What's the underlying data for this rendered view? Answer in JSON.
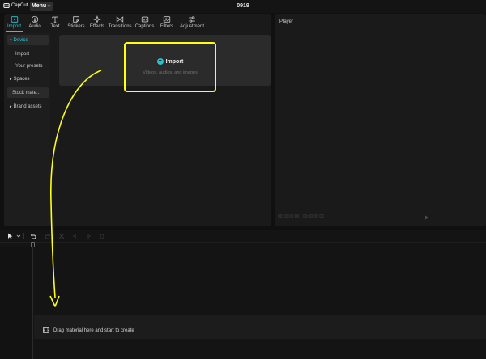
{
  "titlebar": {
    "logo_text": "CapCut",
    "menu_label": "Menu",
    "project_title": "0919"
  },
  "toolbar": {
    "tabs": [
      {
        "label": "Import",
        "icon": "import-icon"
      },
      {
        "label": "Audio",
        "icon": "audio-icon"
      },
      {
        "label": "Text",
        "icon": "text-icon"
      },
      {
        "label": "Stickers",
        "icon": "stickers-icon"
      },
      {
        "label": "Effects",
        "icon": "effects-icon"
      },
      {
        "label": "Transitions",
        "icon": "transitions-icon"
      },
      {
        "label": "Captions",
        "icon": "captions-icon"
      },
      {
        "label": "Filters",
        "icon": "filters-icon"
      },
      {
        "label": "Adjustment",
        "icon": "adjustment-icon"
      }
    ]
  },
  "sidebar": {
    "items": [
      {
        "label": "Device"
      },
      {
        "label": "Import"
      },
      {
        "label": "Your presets"
      },
      {
        "label": "Spaces"
      },
      {
        "label": "Stock mate..."
      },
      {
        "label": "Brand assets"
      }
    ]
  },
  "import_zone": {
    "title": "Import",
    "subtitle": "Videos, audios, and images"
  },
  "player": {
    "title": "Player",
    "timecode": "00:00:00:00 / 00:00:00:00"
  },
  "timeline": {
    "drag_hint": "Drag material here and start to create"
  },
  "colors": {
    "accent": "#2ec8d4",
    "highlight": "#ffff14",
    "panel": "#1a1a1a"
  }
}
